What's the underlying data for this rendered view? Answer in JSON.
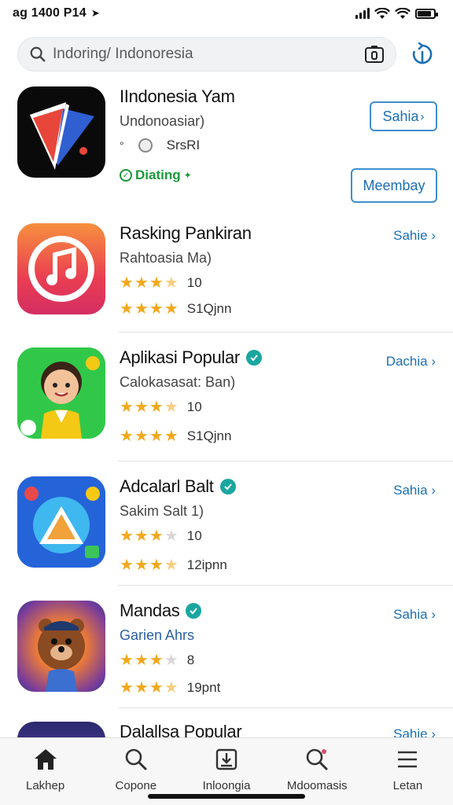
{
  "status_bar": {
    "time": "ag 1400 P14",
    "battery_level": 0.85
  },
  "search": {
    "placeholder": "Indoring/ Indonoresia"
  },
  "colors": {
    "accent": "#1b6fb6",
    "star": "#f2a81d",
    "green": "#1a9a3b",
    "verified": "#1aa6a0"
  },
  "apps": [
    {
      "name": "IIndonesia Yam",
      "subtitle": "Undonoasiar)",
      "meta": "SrsRI",
      "status": "Diating",
      "action_label": "Sahia",
      "secondary_label": "Meembay"
    },
    {
      "name": "Rasking Pankiran",
      "subtitle": "Rahtoasia Ma)",
      "rating_stars": 3.5,
      "rating_value": "10",
      "stars2": 4,
      "downloads": "S1Qjnn",
      "action_label": "Sahie"
    },
    {
      "name": "Aplikasi  Popular",
      "verified": true,
      "subtitle": "Calokasasat: Ban)",
      "rating_stars": 3.5,
      "rating_value": "10",
      "stars2": 4,
      "downloads": "S1Qjnn",
      "action_label": "Dachia"
    },
    {
      "name": "Adcalarl Balt",
      "verified": true,
      "subtitle": "Sakim Salt 1)",
      "rating_stars": 3,
      "rating_value": "10",
      "stars2": 3.5,
      "downloads": "12ipnn",
      "action_label": "Sahia"
    },
    {
      "name": "Mandas",
      "verified": true,
      "subtitle": "Garien  Ahrs",
      "rating_stars": 3,
      "rating_value": "8",
      "stars2": 3.5,
      "downloads": "19pnt",
      "action_label": "Sahia"
    },
    {
      "name": "Dalallsa Popular",
      "action_label": "Sahie"
    }
  ],
  "tabs": [
    {
      "label": "Lakhep",
      "icon": "home-icon"
    },
    {
      "label": "Copone",
      "icon": "search-icon"
    },
    {
      "label": "Inloongia",
      "icon": "download-icon"
    },
    {
      "label": "Mdoomasis",
      "icon": "search-icon"
    },
    {
      "label": "Letan",
      "icon": "menu-icon"
    }
  ]
}
